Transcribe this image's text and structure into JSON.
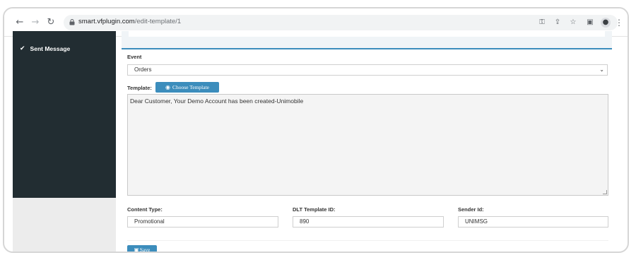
{
  "browser": {
    "url_host": "smart.vfplugin.com",
    "url_path": "/edit-template/1",
    "back_icon": "arrow-left-icon",
    "forward_icon": "arrow-right-icon",
    "reload_icon": "reload-icon",
    "key_icon": "key-icon",
    "share_icon": "share-icon",
    "star_icon": "star-icon",
    "sidepanel_icon": "side-panel-icon",
    "profile_icon": "profile-icon",
    "menu_icon": "menu-dots-icon"
  },
  "sidebar": {
    "items": [
      {
        "label": "Sent Message",
        "icon": "check-icon"
      }
    ]
  },
  "form": {
    "event_label": "Event",
    "event_value": "Orders",
    "template_label": "Template:",
    "choose_template_label": "Choose Template",
    "template_text": "Dear Customer, Your Demo Account has been created-Unimobile",
    "content_type_label": "Content Type:",
    "content_type_value": "Promotional",
    "dlt_label": "DLT Template ID:",
    "dlt_value": "890",
    "sender_label": "Sender Id:",
    "sender_value": "UNIMSG",
    "save_label": "Save"
  },
  "colors": {
    "accent": "#3c8dbc",
    "sidebar_bg": "#222d32"
  }
}
